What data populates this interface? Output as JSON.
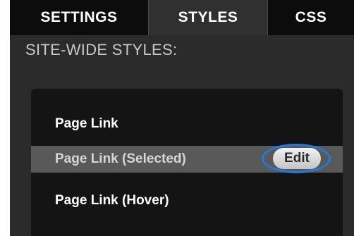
{
  "tabs": [
    {
      "label": "SETTINGS"
    },
    {
      "label": "STYLES",
      "active": true
    },
    {
      "label": "CSS"
    }
  ],
  "section": {
    "title": "SITE-WIDE STYLES:"
  },
  "styles": [
    {
      "label": "Page Link"
    },
    {
      "label": "Page Link (Selected)",
      "selected": true,
      "action_label": "Edit"
    },
    {
      "label": "Page Link (Hover)"
    }
  ],
  "colors": {
    "panel_background": "#2b2b2b",
    "inactive_tab": "#0c0c0c",
    "active_tab": "#303030",
    "list_background": "#141414",
    "selected_row": "#595959",
    "highlight_ring": "#1e7be0"
  }
}
